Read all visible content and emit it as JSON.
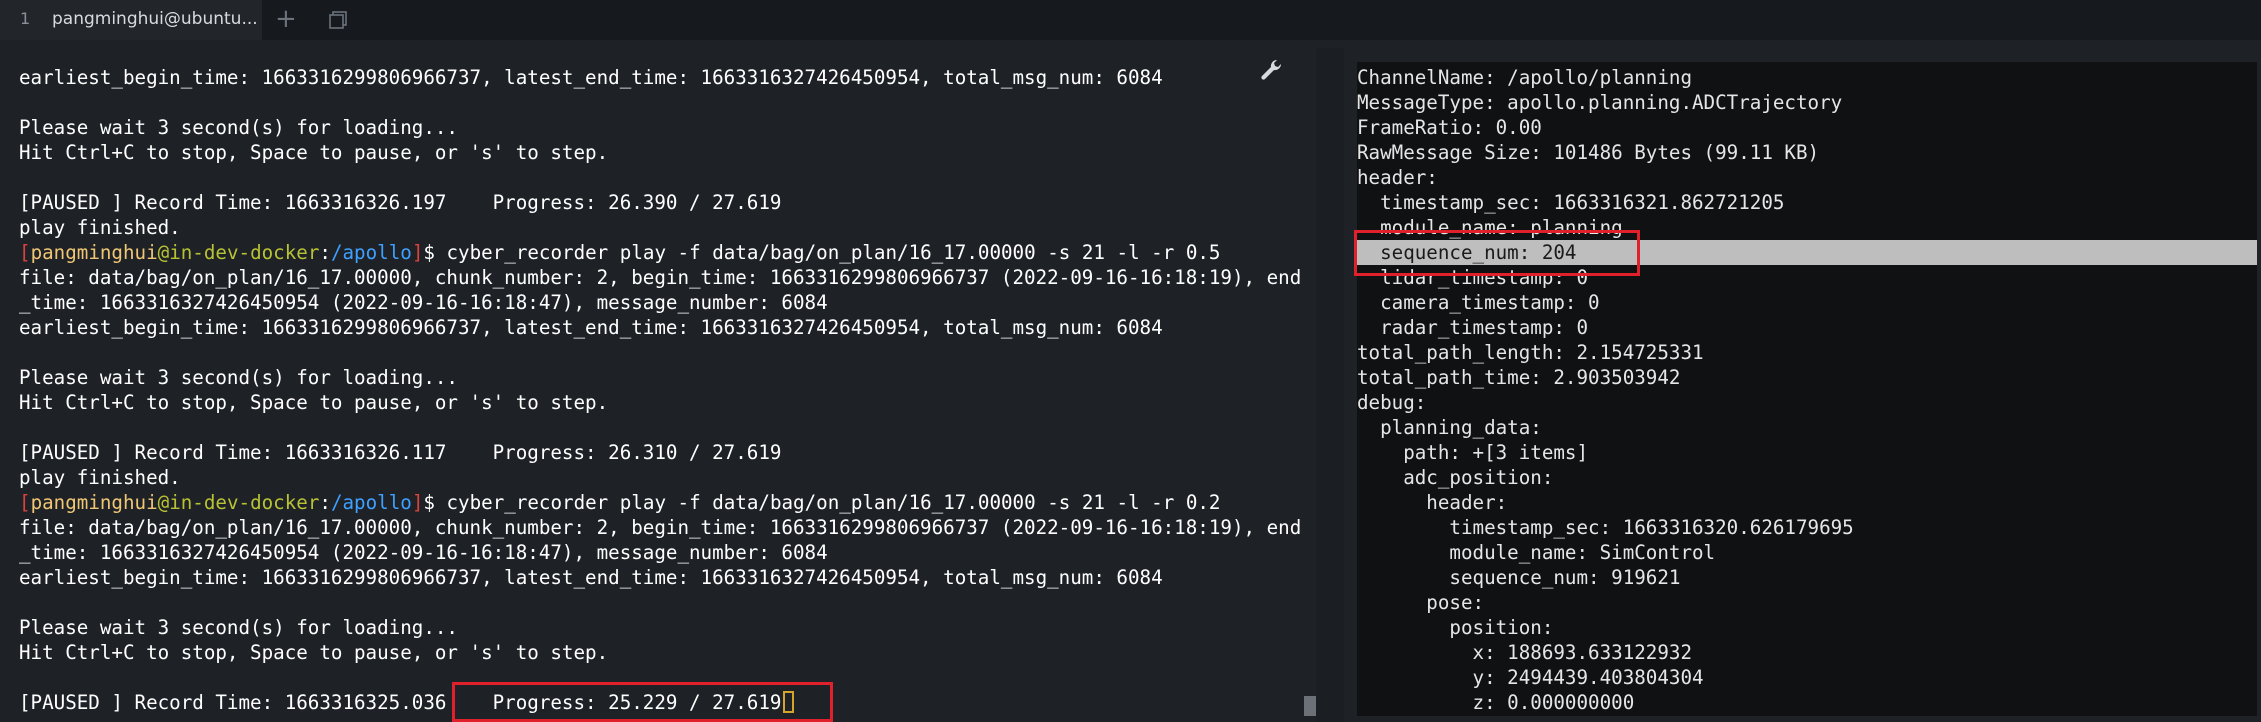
{
  "tabbar": {
    "tab_index": "1",
    "tab_title": "pangminghui@ubuntu...",
    "new_tab_glyph": "+",
    "icons": [
      "new-tab-icon",
      "copy-window-icon"
    ]
  },
  "terminal_left": {
    "prompt": {
      "user": "pangminghui",
      "at": "@",
      "host": "in-dev-docker",
      "sep": ":",
      "path": "/apollo",
      "end": "$"
    },
    "lines": [
      "earliest_begin_time: 1663316299806966737, latest_end_time: 1663316327426450954, total_msg_num: 6084",
      "",
      "Please wait 3 second(s) for loading...",
      "Hit Ctrl+C to stop, Space to pause, or 's' to step.",
      "",
      "[PAUSED ] Record Time: 1663316326.197    Progress: 26.390 / 27.619",
      "play finished.",
      "",
      "file: data/bag/on_plan/16_17.00000, chunk_number: 2, begin_time: 1663316299806966737 (2022-09-16-16:18:19), end",
      "_time: 1663316327426450954 (2022-09-16-16:18:47), message_number: 6084",
      "earliest_begin_time: 1663316299806966737, latest_end_time: 1663316327426450954, total_msg_num: 6084",
      "",
      "Please wait 3 second(s) for loading...",
      "Hit Ctrl+C to stop, Space to pause, or 's' to step.",
      "",
      "[PAUSED ] Record Time: 1663316326.117    Progress: 26.310 / 27.619",
      "play finished.",
      "",
      "file: data/bag/on_plan/16_17.00000, chunk_number: 2, begin_time: 1663316299806966737 (2022-09-16-16:18:19), end",
      "_time: 1663316327426450954 (2022-09-16-16:18:47), message_number: 6084",
      "earliest_begin_time: 1663316299806966737, latest_end_time: 1663316327426450954, total_msg_num: 6084",
      "",
      "Please wait 3 second(s) for loading...",
      "Hit Ctrl+C to stop, Space to pause, or 's' to step.",
      "",
      "[PAUSED ] Record Time: 1663316325.036    Progress: 25.229 / 27.619"
    ],
    "commands": [
      " cyber_recorder play -f data/bag/on_plan/16_17.00000 -s 21 -l -r 0.5",
      " cyber_recorder play -f data/bag/on_plan/16_17.00000 -s 21 -l -r 0.2"
    ]
  },
  "terminal_right": {
    "lines": [
      "ChannelName: /apollo/planning",
      "MessageType: apollo.planning.ADCTrajectory",
      "FrameRatio: 0.00",
      "RawMessage Size: 101486 Bytes (99.11 KB)",
      "header:",
      "  timestamp_sec: 1663316321.862721205",
      "  module_name: planning",
      "  sequence_num: 204",
      "  lidar_timestamp: 0",
      "  camera_timestamp: 0",
      "  radar_timestamp: 0",
      "total_path_length: 2.154725331",
      "total_path_time: 2.903503942",
      "debug:",
      "  planning_data:",
      "    path: +[3 items]",
      "    adc_position:",
      "      header:",
      "        timestamp_sec: 1663316320.626179695",
      "        module_name: SimControl",
      "        sequence_num: 919621",
      "      pose:",
      "        position:",
      "          x: 188693.633122932",
      "          y: 2494439.403804304",
      "          z: 0.000000000"
    ]
  },
  "colors": {
    "background": "#1e2227",
    "prompt_user": "#f0c674",
    "prompt_host": "#b8c233",
    "prompt_path": "#3ea0ff",
    "highlight_box": "#e0202a"
  }
}
